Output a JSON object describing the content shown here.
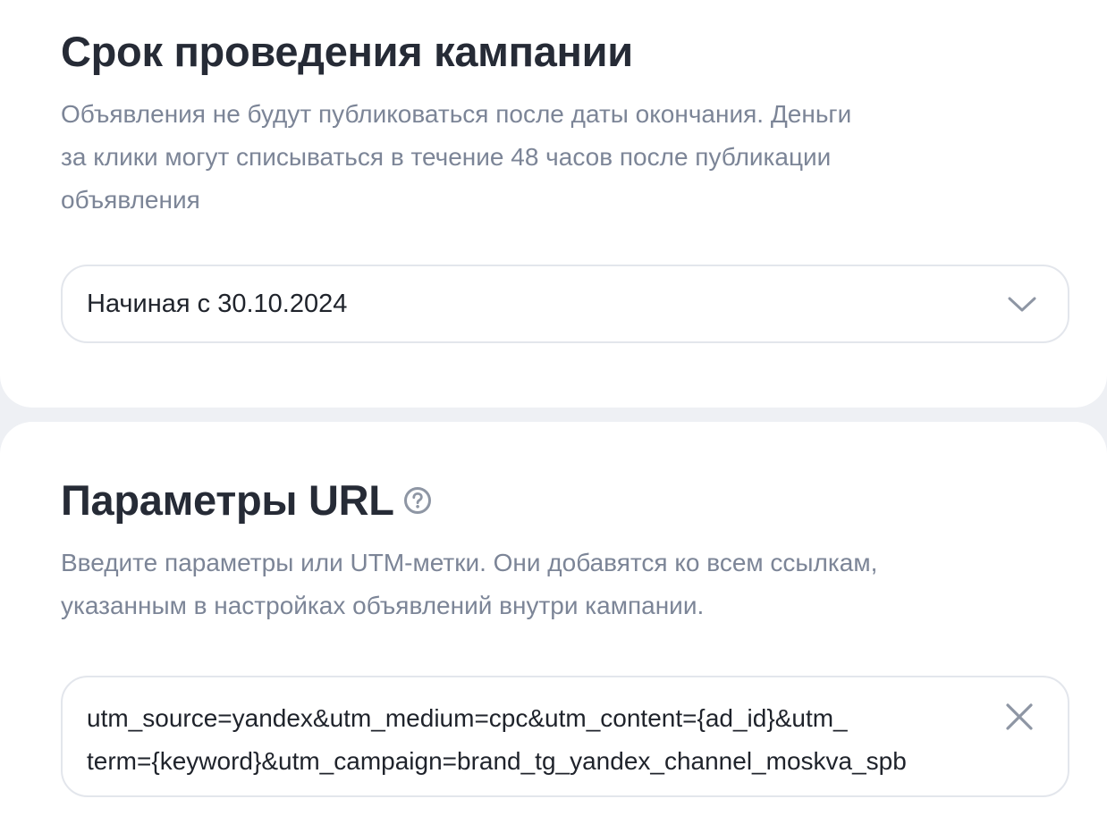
{
  "campaign_period": {
    "title": "Срок проведения кампании",
    "description_lines": [
      "Объявления не будут публиковаться после даты окончания. Деньги",
      "за клики могут списываться в течение 48 часов после публикации",
      "объявления"
    ],
    "period_select": {
      "value": "Начиная с 30.10.2024",
      "icon": "chevron-down-icon"
    }
  },
  "url_params": {
    "title": "Параметры URL",
    "help_icon": "question-circle-icon",
    "description_lines": [
      "Введите параметры или UTM-метки. Они добавятся ко всем ссылкам,",
      "указанным в настройках объявлений внутри кампании."
    ],
    "input": {
      "value_lines": [
        "utm_source=yandex&utm_medium=cpc&utm_content={ad_id}&utm_",
        "term={keyword}&utm_campaign=brand_tg_yandex_channel_moskva_spb"
      ],
      "clear_icon": "close-icon"
    }
  },
  "colors": {
    "background": "#eef0f4",
    "card": "#ffffff",
    "title": "#262b36",
    "secondary_text": "#7c8597",
    "border": "#e3e6ec",
    "icon": "#8e96a4"
  }
}
